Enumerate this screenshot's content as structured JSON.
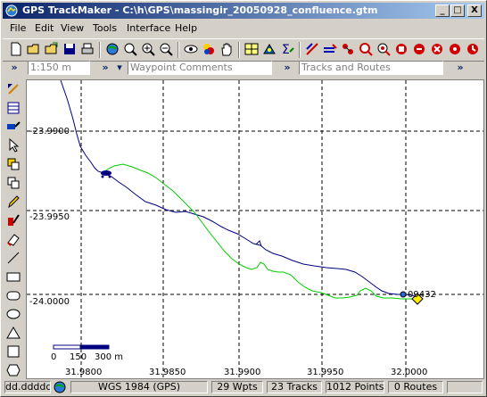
{
  "window": {
    "title": "GPS TrackMaker - C:\\h\\GPS\\massingir_20050928_confluence.gtm"
  },
  "title_buttons": {
    "minimize": "_",
    "maximize": "□",
    "close": "X"
  },
  "menu": [
    "File",
    "Edit",
    "View",
    "Tools",
    "Interface",
    "Help"
  ],
  "toolbar2": {
    "chevron": "»",
    "scale_value": "1:150 m",
    "dropdown_arrow": "▾",
    "waypoint_comments_placeholder": "Waypoint Comments",
    "tracks_routes_placeholder": "Tracks and Routes"
  },
  "map": {
    "y_labels": [
      "-23.9900",
      "-23.9950",
      "-24.0000"
    ],
    "x_labels": [
      "31.9800",
      "31.9850",
      "31.9900",
      "31.9950",
      "32.0000"
    ],
    "waypoint_label": "09432",
    "scalebar": {
      "labels": [
        "0",
        "150",
        "300 m"
      ]
    },
    "colors": {
      "track_blue": "#000080",
      "track_green": "#00cc00",
      "grid": "#000000",
      "waypoint": "#ffee00"
    }
  },
  "statusbar": {
    "coord_format": "dd.ddddd",
    "datum": "WGS 1984 (GPS)",
    "waypoints": "29 Wpts",
    "tracks": "23 Tracks",
    "points": "1012 Points",
    "routes": "0 Routes"
  }
}
